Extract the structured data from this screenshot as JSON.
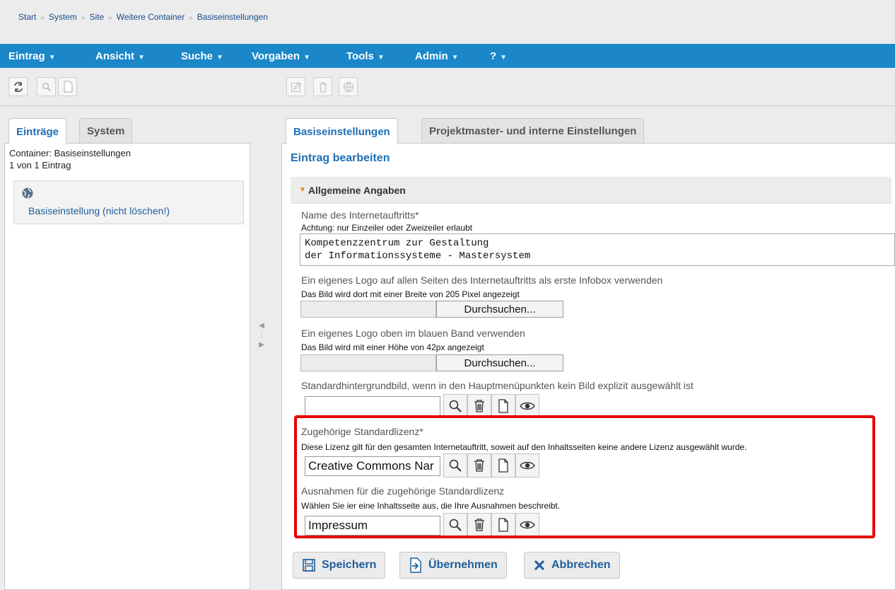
{
  "breadcrumb": [
    "Start",
    "System",
    "Site",
    "Weitere Container",
    "Basiseinstellungen"
  ],
  "menu": [
    {
      "label": "Eintrag"
    },
    {
      "label": "Ansicht"
    },
    {
      "label": "Suche"
    },
    {
      "label": "Vorgaben"
    },
    {
      "label": "Tools"
    },
    {
      "label": "Admin"
    },
    {
      "label": "?"
    }
  ],
  "left": {
    "tabs": [
      "Einträge",
      "System"
    ],
    "container_label": "Container: Basiseinstellungen",
    "count_label": "1 von 1 Eintrag",
    "entry_label": "Basiseinstellung (nicht löschen!)"
  },
  "right": {
    "tabs": [
      "Basiseinstellungen",
      "Projektmaster- und interne Einstellungen"
    ],
    "heading": "Eintrag bearbeiten",
    "section_title": "Allgemeine Angaben",
    "fields": {
      "site_name": {
        "label": "Name des Internetauftritts*",
        "hint": "Achtung: nur Einzeiler oder Zweizeiler erlaubt",
        "value": "Kompetenzzentrum zur Gestaltung\nder Informationssysteme - Mastersystem"
      },
      "logo_infobox": {
        "label": "Ein eigenes Logo auf allen Seiten des Internetauftritts als erste Infobox verwenden",
        "hint": "Das Bild wird dort mit einer Breite von 205 Pixel angezeigt",
        "button": "Durchsuchen..."
      },
      "logo_band": {
        "label": "Ein eigenes Logo oben im blauen Band verwenden",
        "hint": "Das Bild wird mit einer Höhe von 42px angezeigt",
        "button": "Durchsuchen..."
      },
      "background": {
        "label": "Standardhintergrundbild, wenn in den Hauptmenüpunkten kein Bild explizit ausgewählt ist",
        "value": ""
      },
      "license": {
        "label": "Zugehörige Standardlizenz*",
        "hint": "Diese Lizenz gilt für den gesamten Internetauftritt, soweit auf den Inhaltsseiten keine andere Lizenz ausgewählt wurde.",
        "value": "Creative Commons Nar"
      },
      "license_exceptions": {
        "label": "Ausnahmen für die zugehörige Standardlizenz",
        "hint": "Wählen Sie ier eine Inhaltsseite aus, die Ihre Ausnahmen beschreibt.",
        "value": "Impressum"
      }
    },
    "actions": {
      "save": "Speichern",
      "apply": "Übernehmen",
      "cancel": "Abbrechen"
    }
  },
  "colors": {
    "menubar": "#1b87c9",
    "accent_text": "#1f6fb3",
    "highlight": "#e60000"
  }
}
